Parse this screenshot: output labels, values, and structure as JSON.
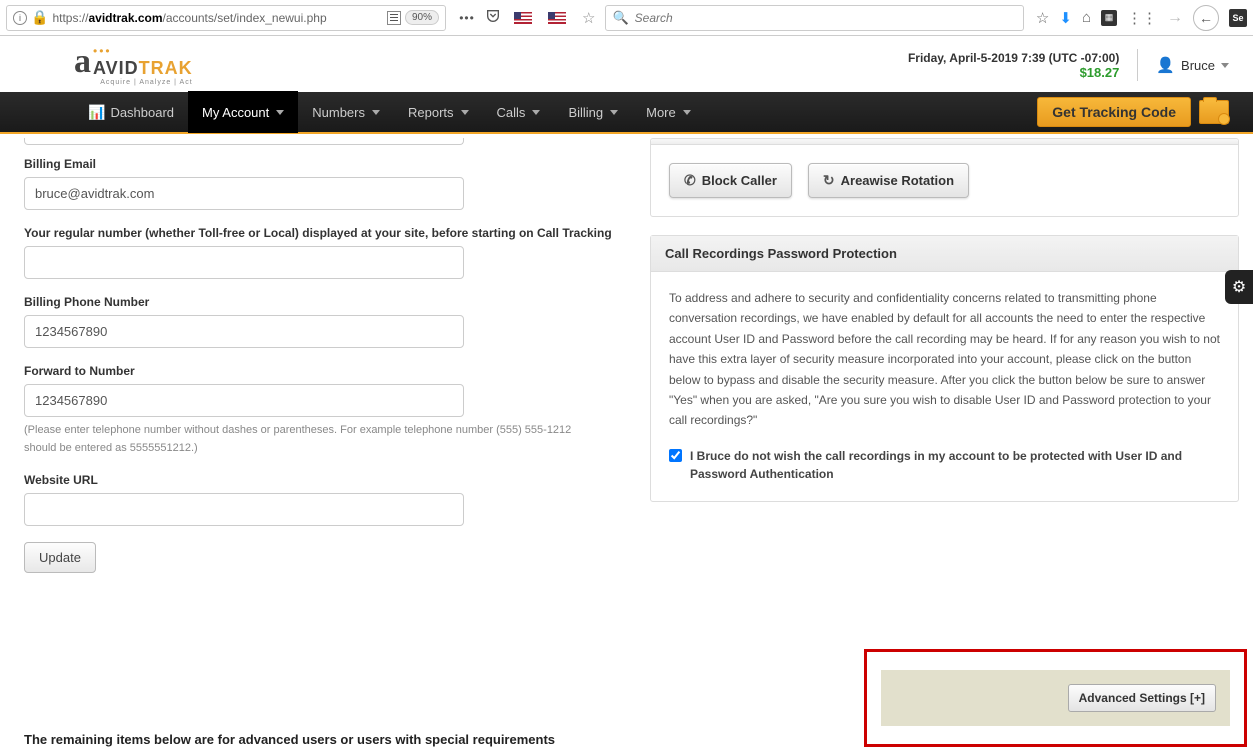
{
  "browser": {
    "url_prefix": "https://",
    "url_host": "avidtrak.com",
    "url_path": "/accounts/set/index_newui.php",
    "zoom": "90%",
    "search_placeholder": "Search"
  },
  "header": {
    "logo_main": "AVID",
    "logo_suffix": "TRAK",
    "logo_sub": "Acquire | Analyze | Act",
    "datetime": "Friday, April-5-2019 7:39 (UTC -07:00)",
    "balance": "$18.27",
    "user": "Bruce"
  },
  "nav": {
    "dashboard": "Dashboard",
    "myaccount": "My Account",
    "numbers": "Numbers",
    "reports": "Reports",
    "calls": "Calls",
    "billing": "Billing",
    "more": "More",
    "tracking_btn": "Get Tracking Code"
  },
  "form": {
    "billing_email_label": "Billing Email",
    "billing_email_value": "bruce@avidtrak.com",
    "regular_number_label": "Your regular number (whether Toll-free or Local) displayed at your site, before starting on Call Tracking",
    "regular_number_value": "",
    "billing_phone_label": "Billing Phone Number",
    "billing_phone_value": "1234567890",
    "forward_label": "Forward to Number",
    "forward_value": "1234567890",
    "forward_help": "(Please enter telephone number without dashes or parentheses. For example telephone number (555) 555-1212 should be entered as 5555551212.)",
    "website_label": "Website URL",
    "website_value": "",
    "update_btn": "Update"
  },
  "rightpanel": {
    "block_caller": "Block Caller",
    "areawise": "Areawise Rotation",
    "protection_title": "Call Recordings Password Protection",
    "protection_text": "To address and adhere to security and confidentiality concerns related to transmitting phone conversation recordings, we have enabled by default for all accounts the need to enter the respective account User ID and Password before the call recording may be heard. If for any reason you wish to not have this extra layer of security measure incorporated into your account, please click on the button below to bypass and disable the security measure. After you click the button below be sure to answer \"Yes\" when you are asked, \"Are you sure you wish to disable User ID and Password protection to your call recordings?\"",
    "protection_checkbox": "I Bruce do not wish the call recordings in my account to be protected with User ID and Password Authentication"
  },
  "advanced": {
    "note": "The remaining items below are for advanced users or users with special requirements",
    "btn": "Advanced Settings [+]"
  }
}
